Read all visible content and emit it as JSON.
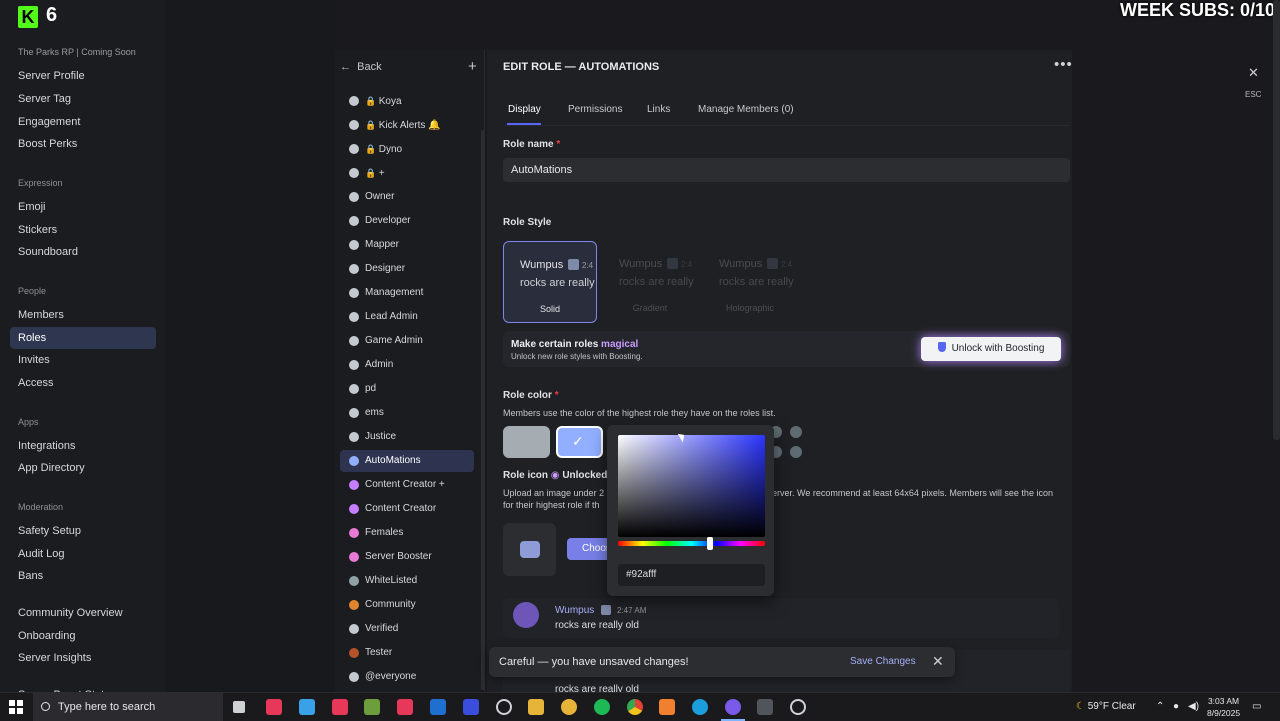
{
  "overlay": {
    "logo_letter": "K",
    "logo_number": "6",
    "week_subs": "WEEK SUBS: 0/10"
  },
  "server": {
    "name": "The Parks RP | Coming Soon"
  },
  "sidebar": {
    "top": [
      "Server Profile",
      "Server Tag",
      "Engagement",
      "Boost Perks"
    ],
    "expression_header": "Expression",
    "expression": [
      "Emoji",
      "Stickers",
      "Soundboard"
    ],
    "people_header": "People",
    "people": [
      "Members",
      "Roles",
      "Invites",
      "Access"
    ],
    "apps_header": "Apps",
    "apps": [
      "Integrations",
      "App Directory"
    ],
    "moderation_header": "Moderation",
    "moderation": [
      "Safety Setup",
      "Audit Log",
      "Bans"
    ],
    "community": [
      "Community Overview",
      "Onboarding",
      "Server Insights"
    ],
    "cut_item": "Server Boost Status",
    "active": "Roles"
  },
  "roles_panel": {
    "back_label": "Back",
    "add_label": "+",
    "lock_icon": "lock-icon",
    "roles": [
      {
        "name": "Koya",
        "color": "#c4c9d0",
        "locked": true
      },
      {
        "name": "Kick Alerts 🔔",
        "color": "#c4c9d0",
        "locked": true
      },
      {
        "name": "Dyno",
        "color": "#c4c9d0",
        "locked": true
      },
      {
        "name": "+",
        "color": "#c4c9d0",
        "locked": true
      },
      {
        "name": "Owner",
        "color": "#c4c9d0"
      },
      {
        "name": "Developer",
        "color": "#c4c9d0"
      },
      {
        "name": "Mapper",
        "color": "#c4c9d0"
      },
      {
        "name": "Designer",
        "color": "#c4c9d0"
      },
      {
        "name": "Management",
        "color": "#c4c9d0"
      },
      {
        "name": "Lead Admin",
        "color": "#c4c9d0"
      },
      {
        "name": "Game Admin",
        "color": "#c4c9d0"
      },
      {
        "name": "Admin",
        "color": "#c4c9d0"
      },
      {
        "name": "pd",
        "color": "#c4c9d0"
      },
      {
        "name": "ems",
        "color": "#c4c9d0"
      },
      {
        "name": "Justice",
        "color": "#c4c9d0"
      },
      {
        "name": "AutoMations",
        "color": "#92afff",
        "active": true
      },
      {
        "name": "Content Creator +",
        "color": "#c77dff"
      },
      {
        "name": "Content Creator",
        "color": "#c77dff"
      },
      {
        "name": "Females",
        "color": "#e879d6"
      },
      {
        "name": "Server Booster",
        "color": "#e879d6"
      },
      {
        "name": "WhiteListed",
        "color": "#8fa2a6"
      },
      {
        "name": "Community",
        "color": "#e0842f"
      },
      {
        "name": "Verified",
        "color": "#c4c9d0"
      },
      {
        "name": "Tester",
        "color": "#b5542b"
      },
      {
        "name": "@everyone",
        "color": "#c4c9d0"
      }
    ]
  },
  "editor": {
    "title": "EDIT ROLE — AUTOMATIONS",
    "more_icon": "more-icon",
    "tabs": [
      "Display",
      "Permissions",
      "Links",
      "Manage Members (0)"
    ],
    "active_tab": "Display",
    "role_name_label": "Role name",
    "required_mark": "*",
    "role_name_value": "AutoMations",
    "role_style_label": "Role Style",
    "style_cards": [
      {
        "label": "Solid",
        "name": "Wumpus",
        "time": "2:4",
        "text": "rocks are really",
        "selected": true
      },
      {
        "label": "Gradient",
        "name": "Wumpus",
        "time": "2:4",
        "text": "rocks are really",
        "selected": false
      },
      {
        "label": "Holographic",
        "name": "Wumpus",
        "time": "2:4",
        "text": "rocks are really",
        "selected": false
      }
    ],
    "boost": {
      "title_prefix": "Make certain roles",
      "title_highlight": "magical",
      "subtitle": "Unlock new role styles with Boosting.",
      "button_label": "Unlock with Boosting"
    },
    "role_color_label": "Role color",
    "role_color_note": "Members use the color of the highest role they have on the roles list.",
    "role_icon_label": "Role icon",
    "role_icon_status": "Unlocked",
    "role_icon_desc_1": "Upload an image under 2",
    "role_icon_desc_1b": "erver. We recommend at least 64x64 pixels. Members will see the icon",
    "role_icon_desc_2": "for their highest role if th",
    "choose_button": "Choose",
    "preview": {
      "author": "Wumpus",
      "time": "2:47 AM",
      "text": "rocks are really old",
      "text2": "rocks are really old"
    }
  },
  "color_picker": {
    "hex": "#92afff"
  },
  "swatches": {
    "default": "#a5adb3",
    "custom": "#92afff",
    "small": [
      "#5f6b73",
      "#5f6b73",
      "#5f6b73",
      "#5f6b73"
    ]
  },
  "unsaved_bar": {
    "message": "Careful — you have unsaved changes!",
    "save_label": "Save Changes"
  },
  "close": {
    "esc_label": "ESC"
  },
  "taskbar": {
    "search_placeholder": "Type here to search",
    "weather": "59°F  Clear",
    "time": "3:03 AM",
    "date": "8/9/2025"
  }
}
